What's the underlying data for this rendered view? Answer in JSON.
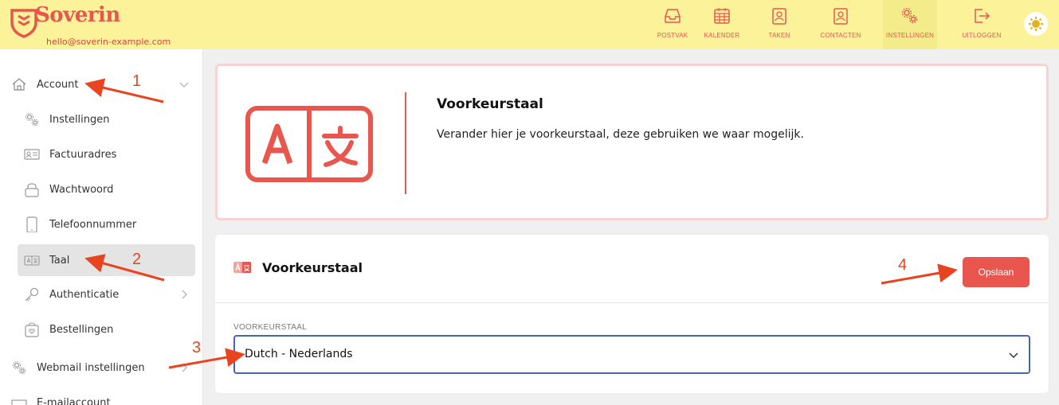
{
  "brand": {
    "name": "Soverin",
    "email": "hello@soverin-example.com"
  },
  "nav": [
    {
      "label": "POSTVAK",
      "icon": "inbox-icon"
    },
    {
      "label": "KALENDER",
      "icon": "calendar-icon"
    },
    {
      "label": "TAKEN",
      "icon": "tasks-icon"
    },
    {
      "label": "CONTACTEN",
      "icon": "contacts-icon"
    },
    {
      "label": "INSTELLINGEN",
      "icon": "settings-icon",
      "active": true
    },
    {
      "label": "UITLOGGEN",
      "icon": "logout-icon"
    }
  ],
  "theme_toggle": {
    "icon": "sun-icon"
  },
  "sidebar": {
    "items": [
      {
        "label": "Account",
        "icon": "home-icon",
        "expanded": true
      },
      {
        "label": "Instellingen",
        "icon": "gears-icon"
      },
      {
        "label": "Factuuradres",
        "icon": "id-card-icon"
      },
      {
        "label": "Wachtwoord",
        "icon": "lock-icon"
      },
      {
        "label": "Telefoonnummer",
        "icon": "phone-icon"
      },
      {
        "label": "Taal",
        "icon": "translate-icon",
        "active": true
      },
      {
        "label": "Authenticatie",
        "icon": "key-icon"
      },
      {
        "label": "Bestellingen",
        "icon": "shopping-bag-icon"
      },
      {
        "label": "Webmail instellingen",
        "icon": "gears-icon"
      },
      {
        "label": "E-mailaccount",
        "icon": "envelope-icon"
      }
    ]
  },
  "hero": {
    "title": "Voorkeurstaal",
    "description": "Verander hier je voorkeurstaal, deze gebruiken we waar mogelijk."
  },
  "card": {
    "title": "Voorkeurstaal",
    "save_label": "Opslaan",
    "field_label": "VOORKEURSTAAL",
    "selected_language": "Dutch - Nederlands"
  },
  "annotations": {
    "n1": "1",
    "n2": "2",
    "n3": "3",
    "n4": "4"
  },
  "colors": {
    "accent": "#e8564e",
    "topbar": "#fbf29a",
    "annotation": "#e8441f",
    "focus": "#4a63b0"
  }
}
